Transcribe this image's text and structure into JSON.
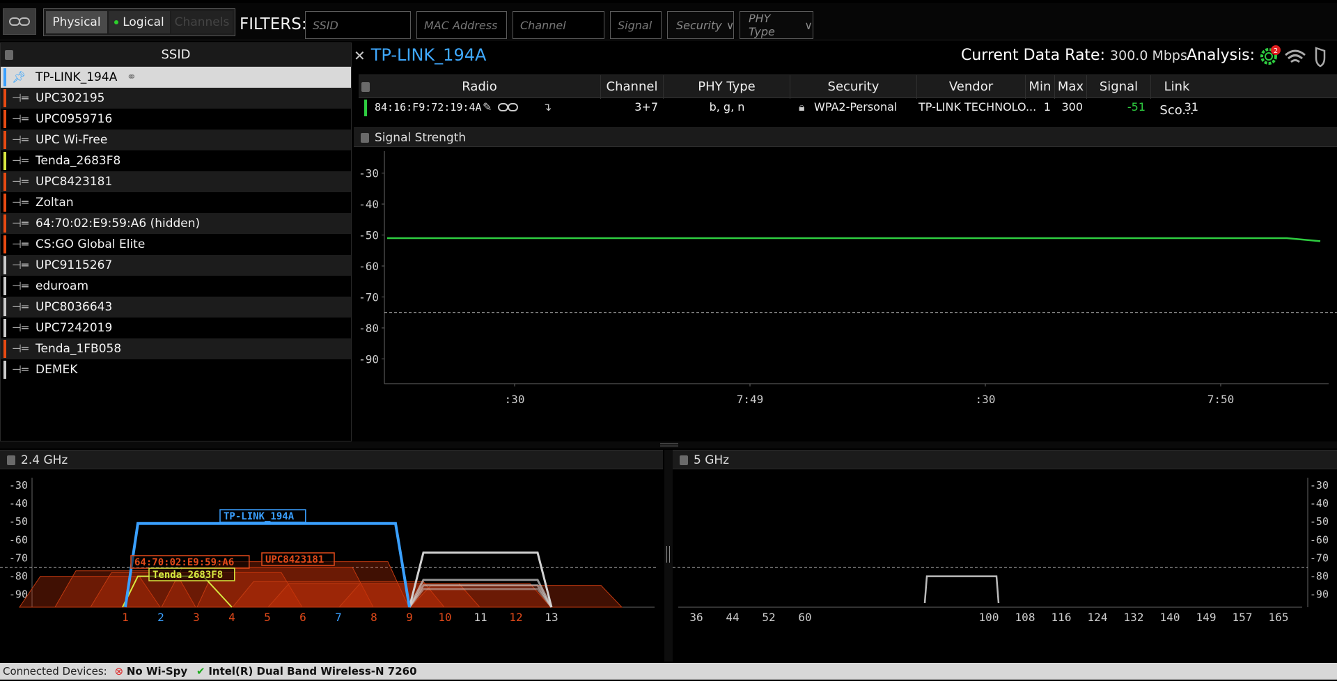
{
  "toolbar": {
    "view_physical": "Physical",
    "view_logical": "Logical",
    "view_channels": "Channels",
    "filters_label": "FILTERS:",
    "filter_ssid": "SSID",
    "filter_mac": "MAC Address",
    "filter_channel": "Channel",
    "filter_signal": "Signal",
    "filter_security": "Security",
    "filter_phy": "PHY Type"
  },
  "ssid_panel": {
    "header": "SSID",
    "items": [
      {
        "name": "TP-LINK_194A",
        "color": "#3aa0ff"
      },
      {
        "name": "UPC302195",
        "color": "#e84a12"
      },
      {
        "name": "UPC0959716",
        "color": "#e84a12"
      },
      {
        "name": "UPC Wi-Free",
        "color": "#e84a12"
      },
      {
        "name": "Tenda_2683F8",
        "color": "#d8e840"
      },
      {
        "name": "UPC8423181",
        "color": "#e84a12"
      },
      {
        "name": "Zoltan",
        "color": "#e84a12"
      },
      {
        "name": "64:70:02:E9:59:A6 (hidden)",
        "color": "#e84a12"
      },
      {
        "name": "CS:GO Global Elite",
        "color": "#e84a12"
      },
      {
        "name": "UPC9115267",
        "color": "#cccccc"
      },
      {
        "name": "eduroam",
        "color": "#cccccc"
      },
      {
        "name": "UPC8036643",
        "color": "#cccccc"
      },
      {
        "name": "UPC7242019",
        "color": "#cccccc"
      },
      {
        "name": "Tenda_1FB058",
        "color": "#e84a12"
      },
      {
        "name": "DEMEK",
        "color": "#cccccc"
      }
    ]
  },
  "detail": {
    "network": "TP-LINK_194A",
    "rate_label": "Current Data Rate:",
    "rate_value": "300.0 Mbps",
    "analysis_label": "Analysis:",
    "analysis_badge": "2",
    "columns": [
      "Radio",
      "Channel",
      "PHY Type",
      "Security",
      "Vendor",
      "Min",
      "Max",
      "Signal",
      "Link Sco..."
    ],
    "row": {
      "radio": "84:16:F9:72:19:4A",
      "channel": "3+7",
      "phy": "b, g, n",
      "security": "WPA2-Personal",
      "vendor": "TP-LINK TECHNOLO...",
      "min": "1",
      "max": "300",
      "signal": "-51",
      "link_score": "31"
    }
  },
  "signal_strength": {
    "title": "Signal Strength",
    "y_ticks": [
      "-30",
      "-40",
      "-50",
      "-60",
      "-70",
      "-80",
      "-90"
    ],
    "x_ticks": [
      ":30",
      "7:49",
      ":30",
      "7:50"
    ]
  },
  "band24": {
    "title": "2.4 GHz",
    "y_ticks": [
      "-30",
      "-40",
      "-50",
      "-60",
      "-70",
      "-80",
      "-90"
    ],
    "channels": [
      "1",
      "2",
      "3",
      "4",
      "5",
      "6",
      "7",
      "8",
      "9",
      "10",
      "11",
      "12",
      "13"
    ],
    "labels": [
      "TP-LINK_194A",
      "64:70:02:E9:59:A6",
      "UPC8423181",
      "Tenda 2683F8"
    ]
  },
  "band5": {
    "title": "5 GHz",
    "y_ticks": [
      "-30",
      "-40",
      "-50",
      "-60",
      "-70",
      "-80",
      "-90"
    ],
    "channels": [
      "36",
      "44",
      "52",
      "60",
      "100",
      "108",
      "116",
      "124",
      "132",
      "140",
      "149",
      "157",
      "165"
    ]
  },
  "status": {
    "label": "Connected Devices:",
    "dev1": "No Wi-Spy",
    "dev2": "Intel(R) Dual Band Wireless-N 7260"
  },
  "chart_data": [
    {
      "type": "line",
      "title": "Signal Strength",
      "x": [
        ":30",
        "7:49",
        ":30",
        "7:50"
      ],
      "series": [
        {
          "name": "TP-LINK_194A",
          "values": [
            -51,
            -51,
            -51,
            -51,
            -52
          ]
        }
      ],
      "ylim": [
        -98,
        -22
      ],
      "threshold": -75
    },
    {
      "type": "area",
      "title": "2.4 GHz",
      "categories": [
        "1",
        "2",
        "3",
        "4",
        "5",
        "6",
        "7",
        "8",
        "9",
        "10",
        "11",
        "12",
        "13"
      ],
      "ylim": [
        -97,
        -22
      ],
      "threshold": -75,
      "series": [
        {
          "name": "TP-LINK_194A",
          "from": 1,
          "to": 9,
          "signal": -51,
          "color": "#3aa0ff"
        },
        {
          "name": "UPC8423181",
          "from": 4,
          "to": 8,
          "signal": -72,
          "color": "#e84a12"
        },
        {
          "name": "64:70:02:E9:59:A6",
          "from": 2,
          "to": 6,
          "signal": -72,
          "color": "#e84a12"
        },
        {
          "name": "Tenda 2683F8",
          "from": 1,
          "to": 5,
          "signal": -80,
          "color": "#d8e840"
        },
        {
          "name": "UPC7242019",
          "from": 9,
          "to": 13,
          "signal": -67,
          "color": "#cccccc"
        }
      ]
    },
    {
      "type": "area",
      "title": "5 GHz",
      "categories": [
        "36",
        "44",
        "52",
        "60",
        "100",
        "108",
        "116",
        "124",
        "132",
        "140",
        "149",
        "157",
        "165"
      ],
      "ylim": [
        -97,
        -22
      ],
      "threshold": -75,
      "series": [
        {
          "name": "",
          "from": "76",
          "to": "100",
          "signal": -80,
          "color": "#cccccc"
        }
      ]
    }
  ]
}
